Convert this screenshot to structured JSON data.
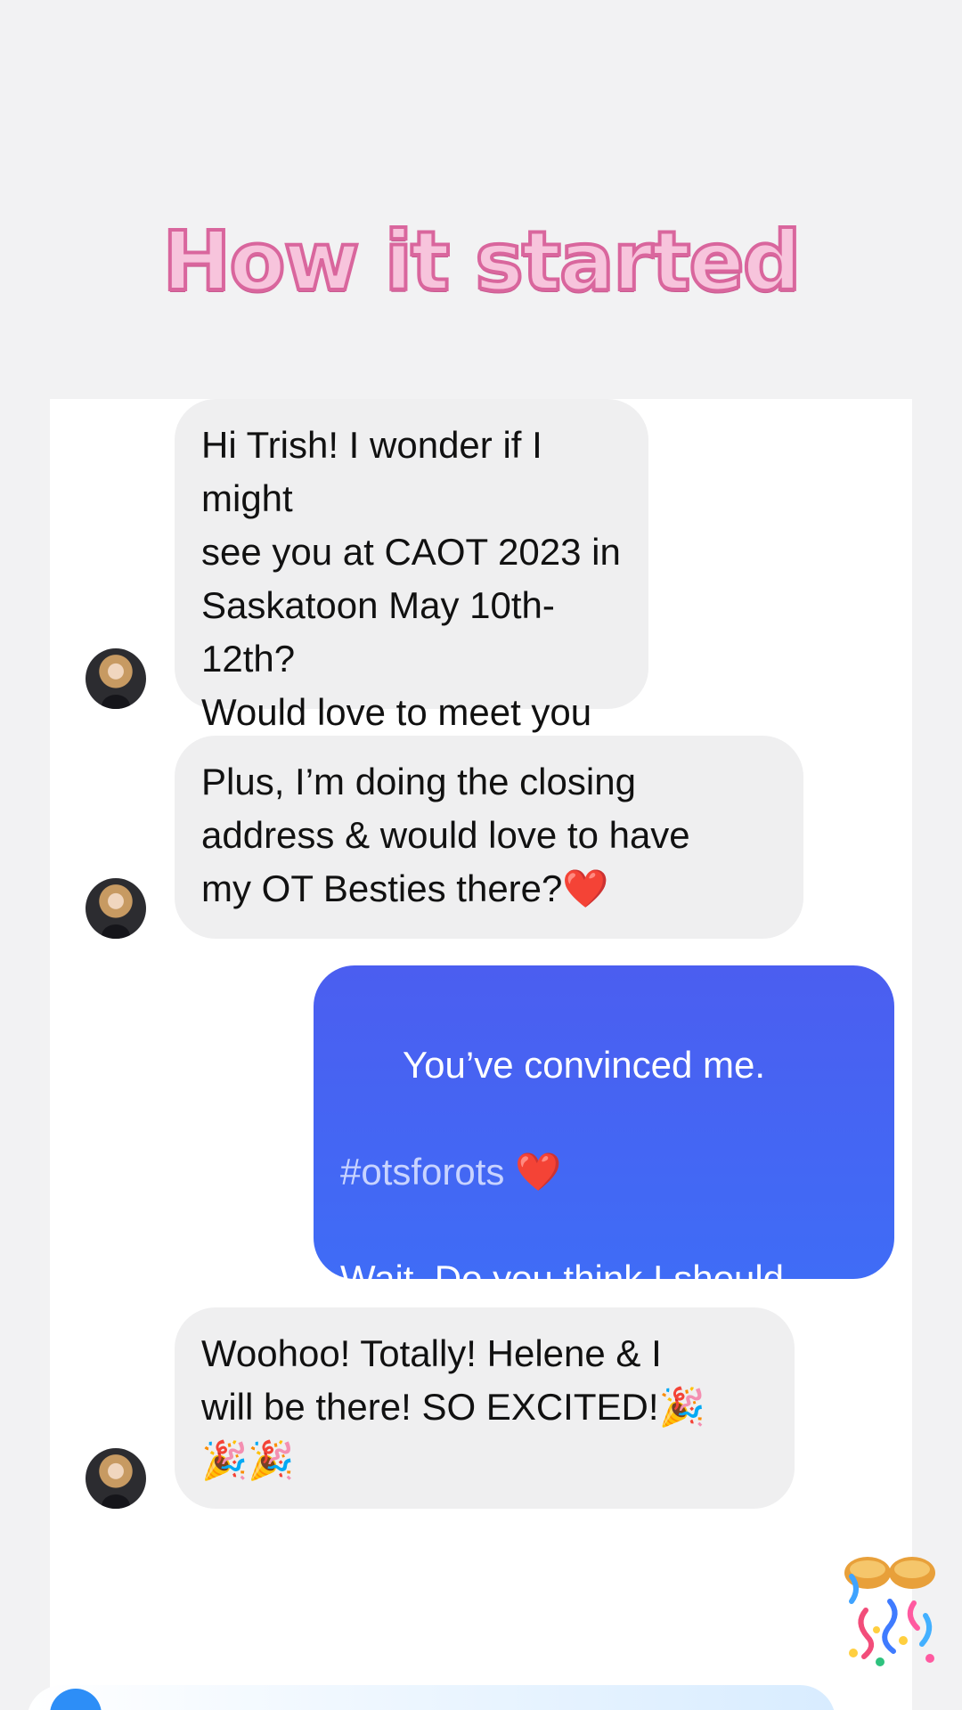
{
  "overlay": {
    "title": "How it started"
  },
  "messages": [
    {
      "direction": "in",
      "text": "Hi Trish! I wonder if I might\nsee you at CAOT 2023 in\nSaskatoon May 10th-12th?\nWould love to meet you in\nperson!"
    },
    {
      "direction": "in",
      "text": "Plus, I’m doing the closing\naddress & would love to have\nmy OT Besties there?❤️"
    },
    {
      "direction": "out",
      "line1": "You’ve convinced me.",
      "hashtag": "#otsforots",
      "hashtag_suffix": " ❤️",
      "line3": "Wait. Do you think I should\nhave a meet up for the OTs\nGet Paid Podcast?? 🎤 🎙️"
    },
    {
      "direction": "in",
      "text": "Woohoo! Totally! Helene & I\nwill be there! SO EXCITED!🎉\n🎉🎉"
    }
  ],
  "colors": {
    "incoming_bubble": "#efeff0",
    "outgoing_bubble": "#4563f3",
    "title_fill": "#f7c4dc",
    "title_stroke": "#d9669d"
  },
  "icons": {
    "avatar": "contact-avatar",
    "sticker": "party-popper-sticker"
  }
}
